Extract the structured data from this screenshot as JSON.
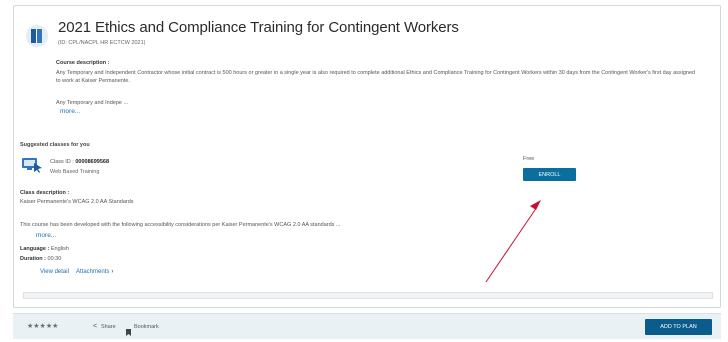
{
  "course": {
    "title": "2021 Ethics and Compliance Training for Contingent Workers",
    "id_line": "(ID: CPL/NACPL HR ECTCW 2021)",
    "description_label": "Course description :",
    "description_text": "Any Temporary and Independent Contractor whose initial contract is 500 hours or greater in a single year is also required to complete additional Ethics and Compliance Training for Contingent Workers within 30 days from the Contingent Worker's first day assigned to work at Kaiser Permanente.",
    "description_short": "Any Temporary and Indepe ...",
    "more_label": "more..."
  },
  "suggested": {
    "heading": "Suggested classes for you",
    "class_id_label": "Class ID :",
    "class_id_value": "00008699568",
    "class_type": "Web Based Training",
    "price": "Free",
    "enroll_label": "ENROLL",
    "class_desc_label": "Class description :",
    "class_desc_text": "Kaiser Permanente's WCAG 2.0 AA Standards",
    "class_desc_long": "This course has been developed with the following accessibility considerations per Kaiser Permanente's WCAG 2.0 AA standards ...",
    "more_label": "more...",
    "language_label": "Language :",
    "language_value": "English",
    "duration_label": "Duration :",
    "duration_value": "00:30",
    "view_detail_label": "View detail",
    "attachments_label": "Attachments"
  },
  "footer": {
    "stars": "★★★★★",
    "share_label": "Share",
    "bookmark_label": "Bookmark",
    "add_to_plan_label": "ADD TO PLAN"
  },
  "colors": {
    "primary_button": "#0a6e9e",
    "link": "#1e6fb5",
    "annotation_arrow": "#c8102e"
  },
  "icons": {
    "course": "book-icon",
    "class": "computer-training-icon",
    "share": "share-icon",
    "bookmark": "bookmark-icon",
    "chevron": "chevron-right-icon"
  }
}
